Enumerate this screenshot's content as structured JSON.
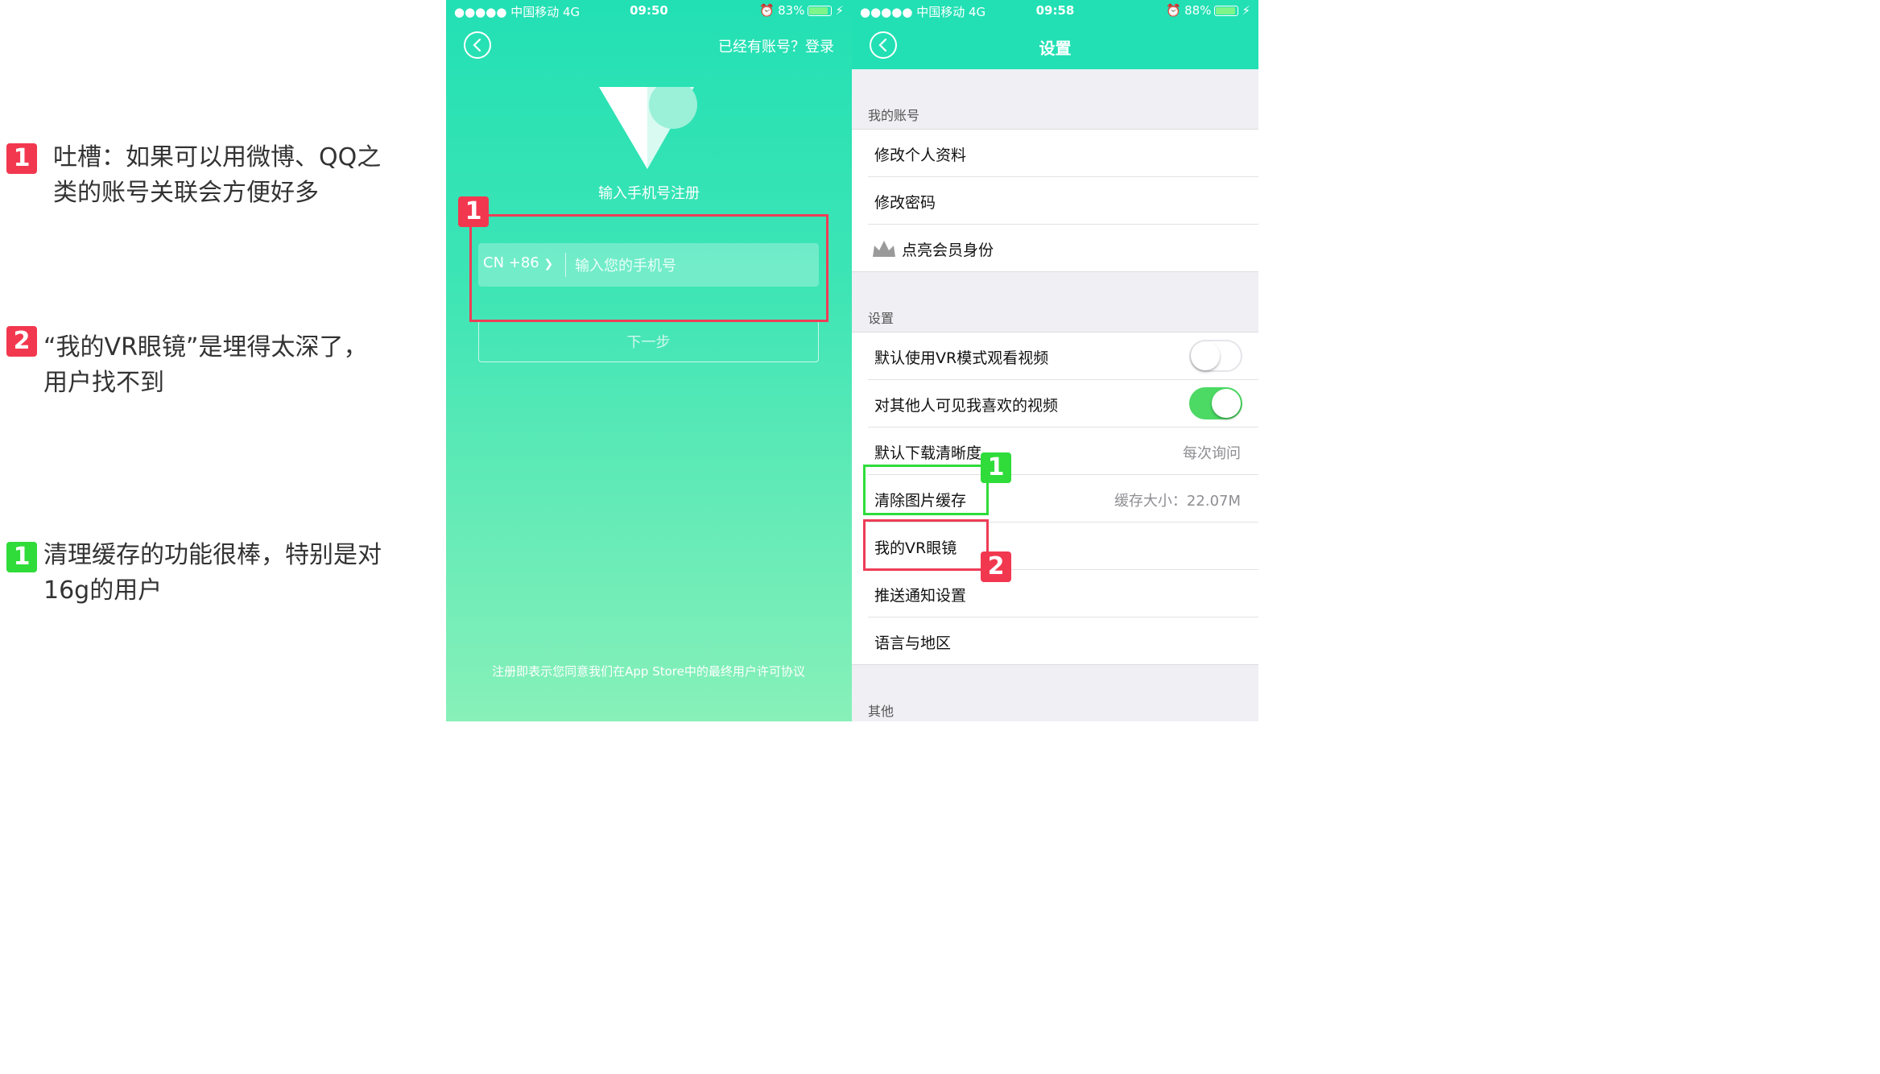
{
  "annotations": [
    {
      "badge": "1",
      "color": "#f2384f",
      "text": "吐槽：如果可以用微博、QQ之\n类的账号关联会方便好多"
    },
    {
      "badge": "2",
      "color": "#f2384f",
      "text": "“我的VR眼镜”是埋得太深了，\n用户找不到"
    },
    {
      "badge": "1",
      "color": "#2fdc3a",
      "text": "清理缓存的功能很棒，特别是对\n16g的用户"
    }
  ],
  "register_screen": {
    "status": {
      "carrier": "●●●●● 中国移动  4G",
      "time": "09:50",
      "battery": "83%"
    },
    "login_link": "已经有账号？登录",
    "title": "输入手机号注册",
    "country_code": "CN +86",
    "phone_placeholder": "输入您的手机号",
    "next_button": "下一步",
    "agreement": "注册即表示您同意我们在App Store中的最终用户许可协议",
    "highlight_badge": "1",
    "colors": {
      "bg_top": "#22e0b4",
      "bg_bottom": "#88f0b9"
    }
  },
  "settings_screen": {
    "status": {
      "carrier": "●●●●● 中国移动  4G",
      "time": "09:58",
      "battery": "88%"
    },
    "title": "设置",
    "section_account": "我的账号",
    "account_items": [
      "修改个人资料",
      "修改密码",
      "点亮会员身份"
    ],
    "section_settings": "设置",
    "settings_items": [
      {
        "label": "默认使用VR模式观看视频",
        "toggle": "off"
      },
      {
        "label": "对其他人可见我喜欢的视频",
        "toggle": "on"
      },
      {
        "label": "默认下载清晰度",
        "value": "每次询问"
      },
      {
        "label": "清除图片缓存",
        "value": "缓存大小：22.07M"
      },
      {
        "label": "我的VR眼镜"
      },
      {
        "label": "推送通知设置"
      },
      {
        "label": "语言与地区"
      }
    ],
    "section_other": "其他",
    "badge_green": "1",
    "badge_red": "2",
    "icons": {
      "back": "back-chevron-icon",
      "member": "crown-icon"
    }
  }
}
